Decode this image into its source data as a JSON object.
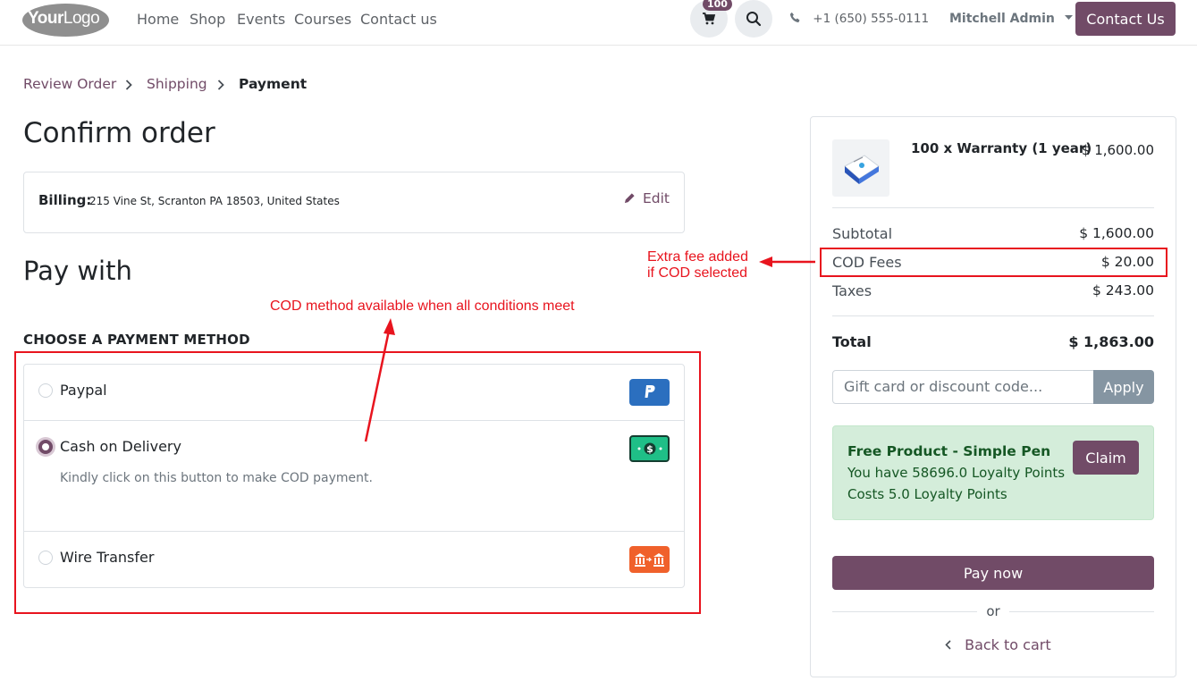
{
  "header": {
    "logo_text_bold": "Your",
    "logo_text_light": "Logo",
    "nav": [
      "Home",
      "Shop",
      "Events",
      "Courses",
      "Contact us"
    ],
    "cart_count": "100",
    "phone": "+1 (650) 555-0111",
    "user": "Mitchell Admin",
    "contact_button": "Contact Us"
  },
  "breadcrumb": {
    "step1": "Review Order",
    "step2": "Shipping",
    "step3": "Payment"
  },
  "main": {
    "title": "Confirm order",
    "billing_label": "Billing:",
    "billing_value": "215 Vine St, Scranton PA 18503, United States",
    "edit_label": "Edit",
    "pay_with": "Pay with",
    "choose_method": "CHOOSE A PAYMENT METHOD",
    "methods": [
      {
        "label": "Paypal",
        "checked": false
      },
      {
        "label": "Cash on Delivery",
        "checked": true,
        "description": "Kindly click on this button to make COD payment."
      },
      {
        "label": "Wire Transfer",
        "checked": false
      }
    ]
  },
  "summary": {
    "product_name": "100 x Warranty (1 year)",
    "product_price": "$ 1,600.00",
    "subtotal_label": "Subtotal",
    "subtotal_value": "$ 1,600.00",
    "cod_label": "COD Fees",
    "cod_value": "$ 20.00",
    "taxes_label": "Taxes",
    "taxes_value": "$ 243.00",
    "total_label": "Total",
    "total_value": "$ 1,863.00",
    "promo_placeholder": "Gift card or discount code...",
    "apply_label": "Apply",
    "reward_title": "Free Product - Simple Pen",
    "reward_points": "You have 58696.0 Loyalty Points",
    "reward_cost": "Costs 5.0 Loyalty Points",
    "claim_label": "Claim",
    "pay_now": "Pay now",
    "or": "or",
    "back_to_cart": "Back to cart"
  },
  "annotations": {
    "cod_method_note": "COD method available when all conditions meet",
    "fee_note_line1": "Extra fee added",
    "fee_note_line2": "if COD selected"
  },
  "colors": {
    "primary": "#714b67",
    "annotation": "#e8141e",
    "reward_bg": "#d4edda",
    "paypal": "#2b6fbf",
    "cod": "#1fbf87",
    "wire": "#f0612b"
  }
}
